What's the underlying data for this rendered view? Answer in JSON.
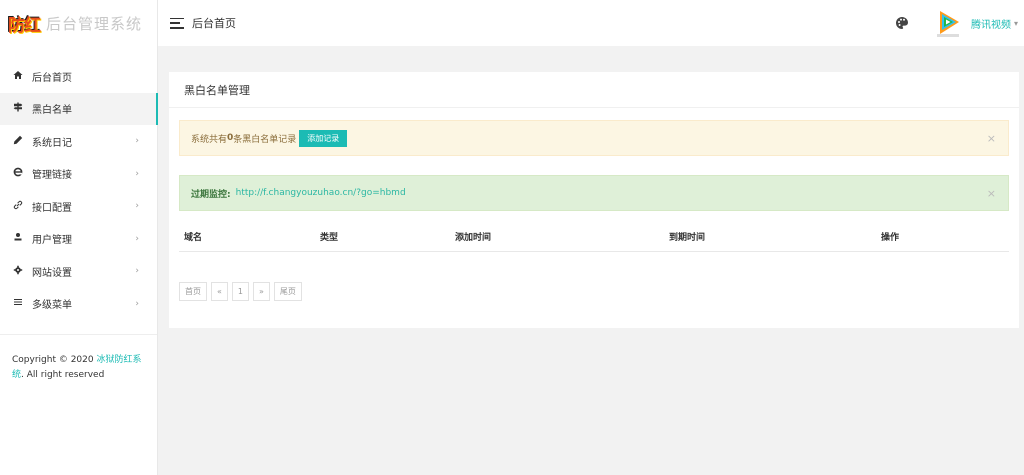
{
  "logo": {
    "badge": "防红",
    "text": "后台管理系统"
  },
  "sidebar": {
    "items": [
      {
        "label": "后台首页",
        "icon": "home-icon"
      },
      {
        "label": "黑白名单",
        "icon": "signpost-icon"
      },
      {
        "label": "系统日记",
        "icon": "pencil-icon"
      },
      {
        "label": "管理链接",
        "icon": "ie-icon"
      },
      {
        "label": "接口配置",
        "icon": "link-icon"
      },
      {
        "label": "用户管理",
        "icon": "user-icon"
      },
      {
        "label": "网站设置",
        "icon": "gear-icon"
      },
      {
        "label": "多级菜单",
        "icon": "menu-icon"
      }
    ],
    "copyright_prefix": "Copyright © 2020 ",
    "copyright_link": "冰狱防红系统",
    "copyright_suffix": ". All right reserved"
  },
  "header": {
    "title": "后台首页",
    "user_name": "腾讯视频"
  },
  "panel": {
    "title": "黑白名单管理",
    "alert_prefix": "系统共有",
    "alert_count": "0",
    "alert_suffix": " 条黑白名单记录",
    "add_button": "添加记录",
    "monitor_label": "过期监控:",
    "monitor_url": "http://f.changyouzuhao.cn/?go=hbmd",
    "columns": [
      "域名",
      "类型",
      "添加时间",
      "到期时间",
      "操作"
    ],
    "pager": [
      "首页",
      "«",
      "1",
      "»",
      "尾页"
    ],
    "close_glyph": "×"
  },
  "colors": {
    "accent": "#1cbbb4",
    "warn_bg": "#fcf6e3",
    "ok_bg": "#dff0d8"
  }
}
